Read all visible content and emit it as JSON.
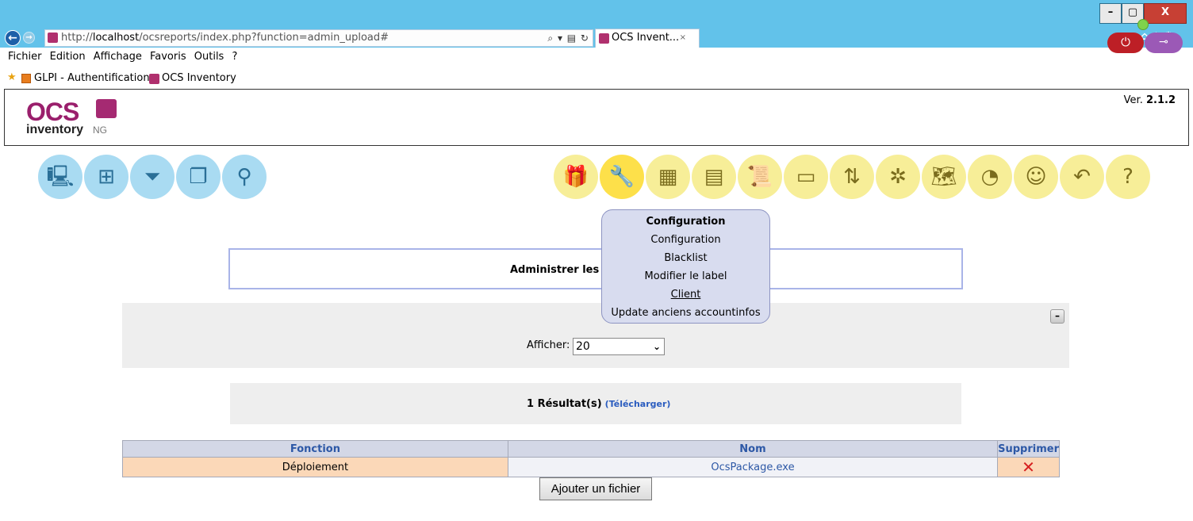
{
  "browser": {
    "window_buttons": {
      "minimize": "–",
      "maximize": "▢",
      "close": "X"
    },
    "address": {
      "prefix": "http://",
      "host": "localhost",
      "path": "/ocsreports/index.php?function=admin_upload#"
    },
    "address_tools": "⌕ ▾ ▤ ↻",
    "tab": {
      "title": "OCS Invent...",
      "close": "×"
    },
    "chrome_icons": "⌂★⚙",
    "menu": [
      "Fichier",
      "Edition",
      "Affichage",
      "Favoris",
      "Outils",
      "?"
    ],
    "favorites": [
      "GLPI - Authentification",
      "OCS Inventory"
    ]
  },
  "header": {
    "logo": {
      "ocs": "OCS",
      "inventory": "inventory",
      "ng": "NG"
    },
    "version_label": "Ver. ",
    "version_number": "2.1.2",
    "status_color": "#7fd34b",
    "power_icon": "⏻",
    "key_icon": "⊸"
  },
  "nav_left": [
    {
      "icon": "computers-icon",
      "glyph": "🖳"
    },
    {
      "icon": "network-icon",
      "glyph": "⊞"
    },
    {
      "icon": "filter-icon",
      "glyph": "⏷"
    },
    {
      "icon": "groups-icon",
      "glyph": "❐"
    },
    {
      "icon": "search-icon",
      "glyph": "⚲"
    }
  ],
  "nav_right": [
    {
      "icon": "package-icon",
      "glyph": "🎁"
    },
    {
      "icon": "wrench-icon",
      "glyph": "🔧"
    },
    {
      "icon": "firewall-icon",
      "glyph": "▦"
    },
    {
      "icon": "inventory-icon",
      "glyph": "▤"
    },
    {
      "icon": "scroll-icon",
      "glyph": "📜"
    },
    {
      "icon": "card-icon",
      "glyph": "▭"
    },
    {
      "icon": "sort-icon",
      "glyph": "⇅"
    },
    {
      "icon": "settings-icon",
      "glyph": "✲"
    },
    {
      "icon": "map-icon",
      "glyph": "🗺"
    },
    {
      "icon": "chart-icon",
      "glyph": "◔"
    },
    {
      "icon": "user-icon",
      "glyph": "☺"
    },
    {
      "icon": "return-icon",
      "glyph": "↶"
    },
    {
      "icon": "help-icon",
      "glyph": "?"
    }
  ],
  "config_menu": {
    "title": "Configuration",
    "items": [
      "Configuration",
      "Blacklist",
      "Modifier le label",
      "Client",
      "Update anciens accountinfos"
    ]
  },
  "page": {
    "title": "Administrer les",
    "afficher_label": "Afficher:",
    "afficher_value": "20",
    "collapse": "–",
    "results_text": "1 Résultat(s)",
    "download_link": "(Télécharger)"
  },
  "table": {
    "headers": [
      "Fonction",
      "Nom",
      "Supprimer"
    ],
    "rows": [
      {
        "fonction": "Déploiement",
        "nom": "OcsPackage.exe",
        "supprimer": "✕"
      }
    ]
  },
  "add_file_button": "Ajouter un fichier"
}
